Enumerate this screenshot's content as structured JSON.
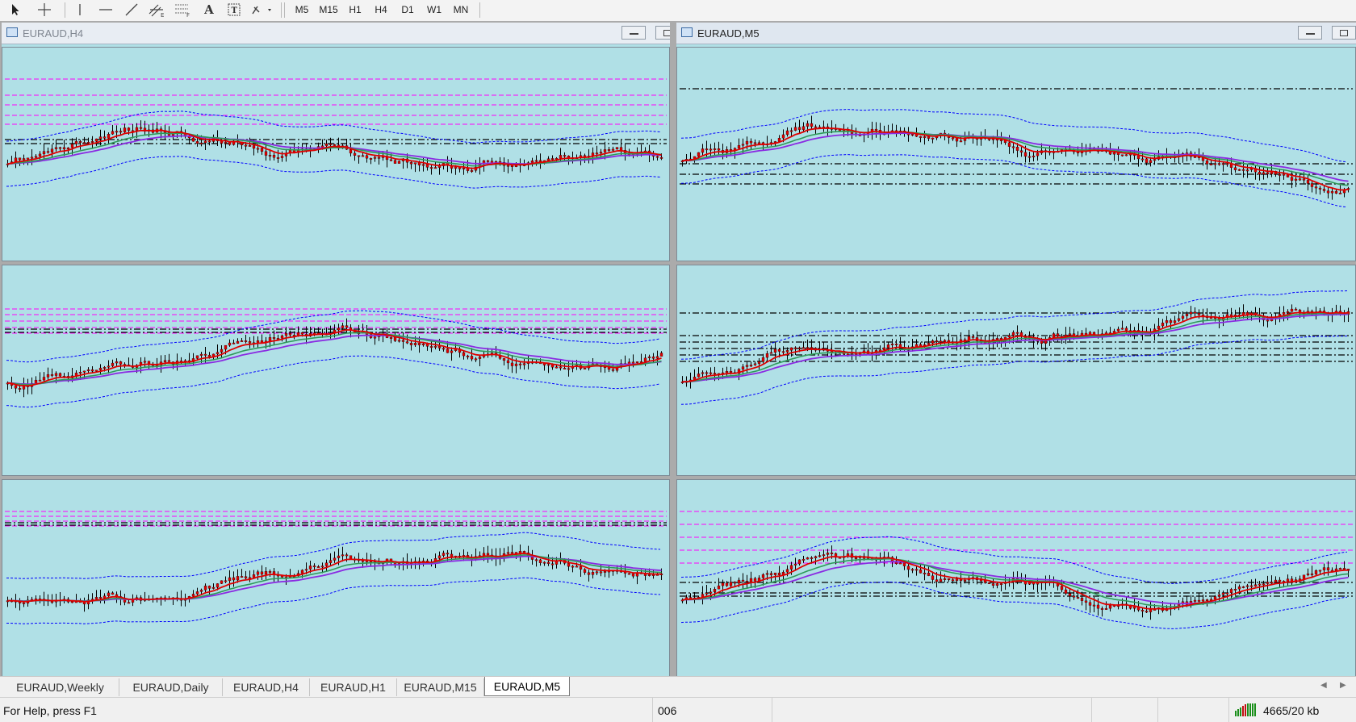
{
  "toolbar": {
    "tools": [
      {
        "name": "cursor-icon"
      },
      {
        "name": "crosshair-icon"
      },
      {
        "name": "vertical-line-icon"
      },
      {
        "name": "horizontal-line-icon"
      },
      {
        "name": "trendline-icon"
      },
      {
        "name": "equidistant-channel-icon"
      },
      {
        "name": "fibonacci-icon"
      },
      {
        "name": "text-icon",
        "glyph": "A"
      },
      {
        "name": "text-label-icon",
        "glyph": "T"
      },
      {
        "name": "arrows-icon"
      }
    ],
    "timeframes": [
      "M5",
      "M15",
      "H1",
      "H4",
      "D1",
      "W1",
      "MN"
    ]
  },
  "windows": [
    {
      "title": "EURAUD,H4",
      "active": false
    },
    {
      "title": "EURAUD,M5",
      "active": true
    }
  ],
  "colors": {
    "chart_bg": "#b0e0e6",
    "candle": "#e00000",
    "wick": "#000000",
    "ma_fast": "#e00000",
    "ma_mid": "#2e9a5a",
    "ma_slow": "#8a2be2",
    "bollinger": "#0000ff",
    "level_magenta": "#ff00ff",
    "level_black": "#000000"
  },
  "tabs": [
    "EURAUD,Weekly",
    "EURAUD,Daily",
    "EURAUD,H4",
    "EURAUD,H1",
    "EURAUD,M15",
    "EURAUD,M5"
  ],
  "active_tab": "EURAUD,M5",
  "status": {
    "help": "For Help, press F1",
    "profile": "006",
    "traffic": "4665/20 kb"
  }
}
